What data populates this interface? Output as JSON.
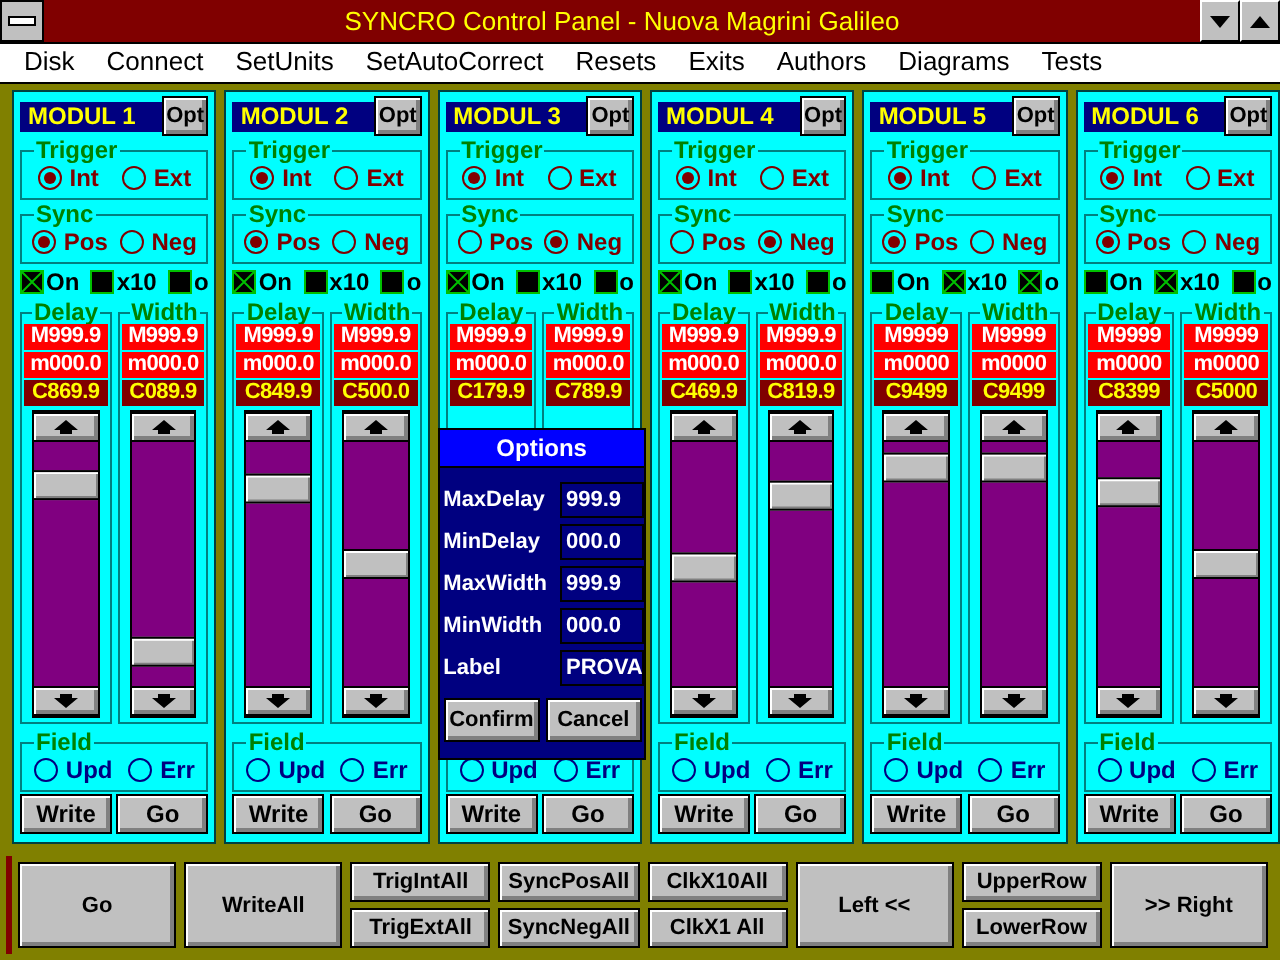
{
  "window": {
    "title": "SYNCRO Control Panel - Nuova Magrini Galileo"
  },
  "menu": [
    "Disk",
    "Connect",
    "SetUnits",
    "SetAutoCorrect",
    "Resets",
    "Exits",
    "Authors",
    "Diagrams",
    "Tests"
  ],
  "modules": [
    {
      "name": "MODUL 1",
      "opt": "Opt",
      "trigger": {
        "label": "Trigger",
        "options": [
          {
            "label": "Int",
            "selected": true
          },
          {
            "label": "Ext",
            "selected": false
          }
        ]
      },
      "sync": {
        "label": "Sync",
        "options": [
          {
            "label": "Pos",
            "selected": true
          },
          {
            "label": "Neg",
            "selected": false
          }
        ]
      },
      "checks": [
        {
          "label": "On",
          "checked": true
        },
        {
          "label": "x10",
          "checked": false
        },
        {
          "label": "o",
          "checked": false
        }
      ],
      "channels": [
        {
          "label": "Delay",
          "max": "M999.9",
          "min": "m000.0",
          "current": "C869.9",
          "level": 0.87
        },
        {
          "label": "Width",
          "max": "M999.9",
          "min": "m000.0",
          "current": "C089.9",
          "level": 0.09
        }
      ],
      "field": {
        "label": "Field",
        "options": [
          {
            "label": "Upd",
            "selected": false
          },
          {
            "label": "Err",
            "selected": false
          }
        ]
      },
      "buttons": [
        "Write",
        "Go"
      ]
    },
    {
      "name": "MODUL 2",
      "opt": "Opt",
      "trigger": {
        "label": "Trigger",
        "options": [
          {
            "label": "Int",
            "selected": true
          },
          {
            "label": "Ext",
            "selected": false
          }
        ]
      },
      "sync": {
        "label": "Sync",
        "options": [
          {
            "label": "Pos",
            "selected": true
          },
          {
            "label": "Neg",
            "selected": false
          }
        ]
      },
      "checks": [
        {
          "label": "On",
          "checked": true
        },
        {
          "label": "x10",
          "checked": false
        },
        {
          "label": "o",
          "checked": false
        }
      ],
      "channels": [
        {
          "label": "Delay",
          "max": "M999.9",
          "min": "m000.0",
          "current": "C849.9",
          "level": 0.85
        },
        {
          "label": "Width",
          "max": "M999.9",
          "min": "m000.0",
          "current": "C500.0",
          "level": 0.5
        }
      ],
      "field": {
        "label": "Field",
        "options": [
          {
            "label": "Upd",
            "selected": false
          },
          {
            "label": "Err",
            "selected": false
          }
        ]
      },
      "buttons": [
        "Write",
        "Go"
      ]
    },
    {
      "name": "MODUL 3",
      "opt": "Opt",
      "trigger": {
        "label": "Trigger",
        "options": [
          {
            "label": "Int",
            "selected": true
          },
          {
            "label": "Ext",
            "selected": false
          }
        ]
      },
      "sync": {
        "label": "Sync",
        "options": [
          {
            "label": "Pos",
            "selected": false
          },
          {
            "label": "Neg",
            "selected": true
          }
        ]
      },
      "checks": [
        {
          "label": "On",
          "checked": true
        },
        {
          "label": "x10",
          "checked": false
        },
        {
          "label": "o",
          "checked": false
        }
      ],
      "channels": [
        {
          "label": "Delay",
          "max": "M999.9",
          "min": "m000.0",
          "current": "C179.9"
        },
        {
          "label": "Width",
          "max": "M999.9",
          "min": "m000.0",
          "current": "C789.9"
        }
      ],
      "field": {
        "options": [
          {
            "label": "Upd",
            "selected": false
          },
          {
            "label": "Err",
            "selected": false
          }
        ]
      },
      "buttons": [
        "Write",
        "Go"
      ],
      "options": {
        "title": "Options",
        "fields": [
          {
            "label": "MaxDelay",
            "value": "999.9"
          },
          {
            "label": "MinDelay",
            "value": "000.0"
          },
          {
            "label": "MaxWidth",
            "value": "999.9"
          },
          {
            "label": "MinWidth",
            "value": "000.0"
          },
          {
            "label": "Label",
            "value": "PROVA"
          }
        ],
        "buttons": [
          "Confirm",
          "Cancel"
        ]
      }
    },
    {
      "name": "MODUL 4",
      "opt": "Opt",
      "trigger": {
        "label": "Trigger",
        "options": [
          {
            "label": "Int",
            "selected": true
          },
          {
            "label": "Ext",
            "selected": false
          }
        ]
      },
      "sync": {
        "label": "Sync",
        "options": [
          {
            "label": "Pos",
            "selected": false
          },
          {
            "label": "Neg",
            "selected": true
          }
        ]
      },
      "checks": [
        {
          "label": "On",
          "checked": true
        },
        {
          "label": "x10",
          "checked": false
        },
        {
          "label": "o",
          "checked": false
        }
      ],
      "channels": [
        {
          "label": "Delay",
          "max": "M999.9",
          "min": "m000.0",
          "current": "C469.9",
          "level": 0.48
        },
        {
          "label": "Width",
          "max": "M999.9",
          "min": "m000.0",
          "current": "C819.9",
          "level": 0.82
        }
      ],
      "field": {
        "label": "Field",
        "options": [
          {
            "label": "Upd",
            "selected": false
          },
          {
            "label": "Err",
            "selected": false
          }
        ]
      },
      "buttons": [
        "Write",
        "Go"
      ]
    },
    {
      "name": "MODUL 5",
      "opt": "Opt",
      "trigger": {
        "label": "Trigger",
        "options": [
          {
            "label": "Int",
            "selected": true
          },
          {
            "label": "Ext",
            "selected": false
          }
        ]
      },
      "sync": {
        "label": "Sync",
        "options": [
          {
            "label": "Pos",
            "selected": true
          },
          {
            "label": "Neg",
            "selected": false
          }
        ]
      },
      "checks": [
        {
          "label": "On",
          "checked": false
        },
        {
          "label": "x10",
          "checked": true
        },
        {
          "label": "o",
          "checked": true
        }
      ],
      "channels": [
        {
          "label": "Delay",
          "max": "M9999",
          "min": "m0000",
          "current": "C9499",
          "level": 0.95
        },
        {
          "label": "Width",
          "max": "M9999",
          "min": "m0000",
          "current": "C9499",
          "level": 0.95
        }
      ],
      "field": {
        "label": "Field",
        "options": [
          {
            "label": "Upd",
            "selected": false
          },
          {
            "label": "Err",
            "selected": false
          }
        ]
      },
      "buttons": [
        "Write",
        "Go"
      ]
    },
    {
      "name": "MODUL 6",
      "opt": "Opt",
      "trigger": {
        "label": "Trigger",
        "options": [
          {
            "label": "Int",
            "selected": true
          },
          {
            "label": "Ext",
            "selected": false
          }
        ]
      },
      "sync": {
        "label": "Sync",
        "options": [
          {
            "label": "Pos",
            "selected": true
          },
          {
            "label": "Neg",
            "selected": false
          }
        ]
      },
      "checks": [
        {
          "label": "On",
          "checked": false
        },
        {
          "label": "x10",
          "checked": true
        },
        {
          "label": "o",
          "checked": false
        }
      ],
      "channels": [
        {
          "label": "Delay",
          "max": "M9999",
          "min": "m0000",
          "current": "C8399",
          "level": 0.84
        },
        {
          "label": "Width",
          "max": "M9999",
          "min": "m0000",
          "current": "C5000",
          "level": 0.5
        }
      ],
      "field": {
        "label": "Field",
        "options": [
          {
            "label": "Upd",
            "selected": false
          },
          {
            "label": "Err",
            "selected": false
          }
        ]
      },
      "buttons": [
        "Write",
        "Go"
      ]
    }
  ],
  "bottom_bar": [
    {
      "kind": "single",
      "label": "Go"
    },
    {
      "kind": "single",
      "label": "WriteAll"
    },
    {
      "kind": "pair",
      "labels": [
        "TrigIntAll",
        "TrigExtAll"
      ]
    },
    {
      "kind": "pair",
      "labels": [
        "SyncPosAll",
        "SyncNegAll"
      ]
    },
    {
      "kind": "pair",
      "labels": [
        "ClkX10All",
        "ClkX1 All"
      ]
    },
    {
      "kind": "single",
      "label": "Left <<"
    },
    {
      "kind": "pair",
      "labels": [
        "UpperRow",
        "LowerRow"
      ]
    },
    {
      "kind": "single",
      "label": ">> Right"
    }
  ]
}
